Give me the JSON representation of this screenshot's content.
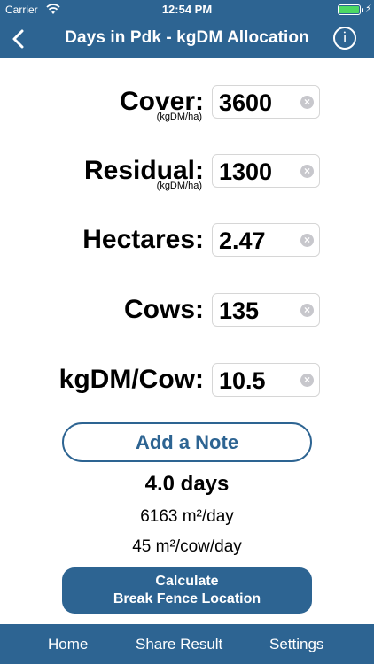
{
  "status": {
    "carrier": "Carrier",
    "time": "12:54 PM"
  },
  "nav": {
    "title": "Days in Pdk - kgDM Allocation",
    "back_icon": "chevron-left-icon",
    "info_icon": "info-icon",
    "info_glyph": "i"
  },
  "fields": [
    {
      "label": "Cover:",
      "unit": "(kgDM/ha)",
      "value": "3600"
    },
    {
      "label": "Residual:",
      "unit": "(kgDM/ha)",
      "value": "1300"
    },
    {
      "label": "Hectares:",
      "unit": "",
      "value": "2.47"
    },
    {
      "label": "Cows:",
      "unit": "",
      "value": "135"
    },
    {
      "label": "kgDM/Cow:",
      "unit": "",
      "value": "10.5"
    }
  ],
  "clear_glyph": "×",
  "note_button": "Add a Note",
  "result": {
    "days": "4.0 days",
    "area_per_day": "6163 m²/day",
    "area_per_cow": "45 m²/cow/day"
  },
  "calc_button": {
    "line1": "Calculate",
    "line2": "Break Fence Location"
  },
  "tabs": [
    "Home",
    "Share Result",
    "Settings"
  ],
  "colors": {
    "brand": "#2d6492",
    "battery": "#4cd964",
    "clear": "#c7c7cc"
  }
}
